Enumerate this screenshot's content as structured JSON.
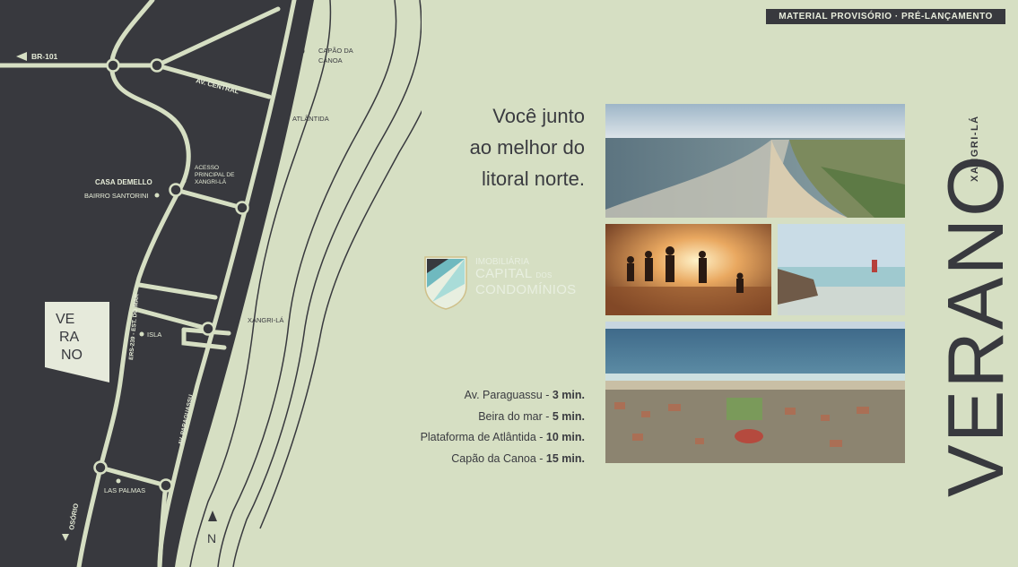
{
  "badge": "MATERIAL PROVISÓRIO · PRÉ-LANÇAMENTO",
  "headline": [
    "Você junto",
    "ao melhor do",
    "litoral norte."
  ],
  "map": {
    "br101": "BR-101",
    "capao_line1": "CAPÃO DA",
    "capao_line2": "CANOA",
    "atlantida": "ATLÂNTIDA",
    "av_central": "AV. CENTRAL",
    "casa_demello": "CASA DEMELLO",
    "bairro_santorini": "BAIRRO SANTORINI",
    "acesso_line1": "ACESSO",
    "acesso_line2": "PRINCIPAL DE",
    "acesso_line3": "XANGRI-LÁ",
    "xangrila": "XANGRI-LÁ",
    "isla": "ISLA",
    "ers": "ERS-239 - EST. DO MAR",
    "av_paraguassu": "AV. PARAGUASSU",
    "las_palmas": "LAS PALMAS",
    "osorio": "OSÓRIO",
    "north": "N"
  },
  "map_badge": {
    "line1": "VE",
    "line2": "RA",
    "line3": "NO"
  },
  "logo": {
    "line1": "IMOBILIÁRIA",
    "line2": "CAPITAL",
    "line2b": "DOS",
    "line3": "CONDOMÍNIOS"
  },
  "distances": [
    {
      "label": "Av. Paraguassu - ",
      "time": "3 min."
    },
    {
      "label": "Beira do mar - ",
      "time": "5 min."
    },
    {
      "label": "Plataforma de Atlântida - ",
      "time": "10 min."
    },
    {
      "label": "Capão da Canoa - ",
      "time": "15 min."
    }
  ],
  "brand": {
    "name": "VERANO",
    "sub": "XANGRI-LÁ"
  },
  "colors": {
    "background": "#d6dfc3",
    "dark": "#38393e",
    "road": "#d6dfc3"
  },
  "icons": [
    "arrow-left-icon",
    "arrow-down-icon",
    "north-arrow-icon",
    "location-dot-icon"
  ]
}
